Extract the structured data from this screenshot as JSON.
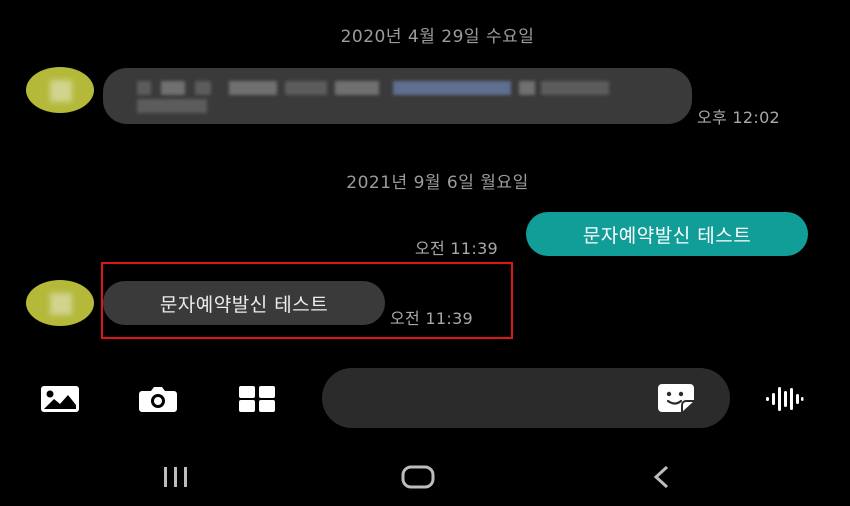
{
  "conversation": {
    "date_separators": [
      "2020년 4월 29일 수요일",
      "2021년 9월 6일 월요일"
    ],
    "messages": [
      {
        "direction": "incoming",
        "text": "",
        "time": "오후 12:02",
        "blurred": true
      },
      {
        "direction": "outgoing",
        "text": "문자예약발신 테스트",
        "time": "오전 11:39"
      },
      {
        "direction": "incoming",
        "text": "문자예약발신 테스트",
        "time": "오전 11:39",
        "highlighted": true
      }
    ]
  },
  "composer": {
    "icons": [
      "image-icon",
      "camera-icon",
      "apps-grid-icon",
      "sticker-icon",
      "voice-icon"
    ]
  },
  "navbar": {
    "icons": [
      "recent-apps-icon",
      "home-icon",
      "back-icon"
    ]
  },
  "colors": {
    "background": "#000000",
    "incoming_bubble": "#3a3a3a",
    "outgoing_bubble": "#129e98",
    "avatar": "#b4b93a",
    "highlight": "#e01515"
  }
}
